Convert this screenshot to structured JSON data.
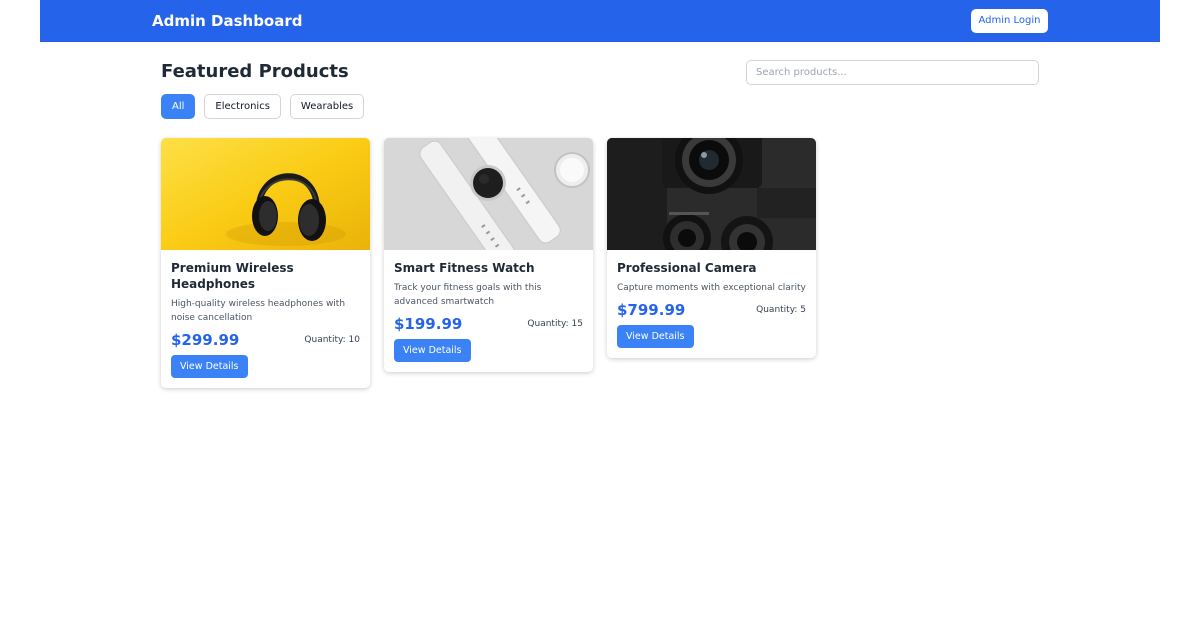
{
  "header": {
    "title": "Admin Dashboard",
    "login_label": "Admin Login"
  },
  "main": {
    "title": "Featured Products",
    "search_placeholder": "Search products...",
    "filters": [
      {
        "label": "All",
        "active": true
      },
      {
        "label": "Electronics",
        "active": false
      },
      {
        "label": "Wearables",
        "active": false
      }
    ],
    "products": [
      {
        "title": "Premium Wireless Headphones",
        "description": "High-quality wireless headphones with noise cancellation",
        "price": "$299.99",
        "quantity": "Quantity: 10",
        "button": "View Details",
        "image": "headphones-photo"
      },
      {
        "title": "Smart Fitness Watch",
        "description": "Track your fitness goals with this advanced smartwatch",
        "price": "$199.99",
        "quantity": "Quantity: 15",
        "button": "View Details",
        "image": "smartwatch-photo"
      },
      {
        "title": "Professional Camera",
        "description": "Capture moments with exceptional clarity",
        "price": "$799.99",
        "quantity": "Quantity: 5",
        "button": "View Details",
        "image": "camera-photo"
      }
    ]
  },
  "colors": {
    "accent": "#2563eb",
    "button": "#3b82f6"
  }
}
